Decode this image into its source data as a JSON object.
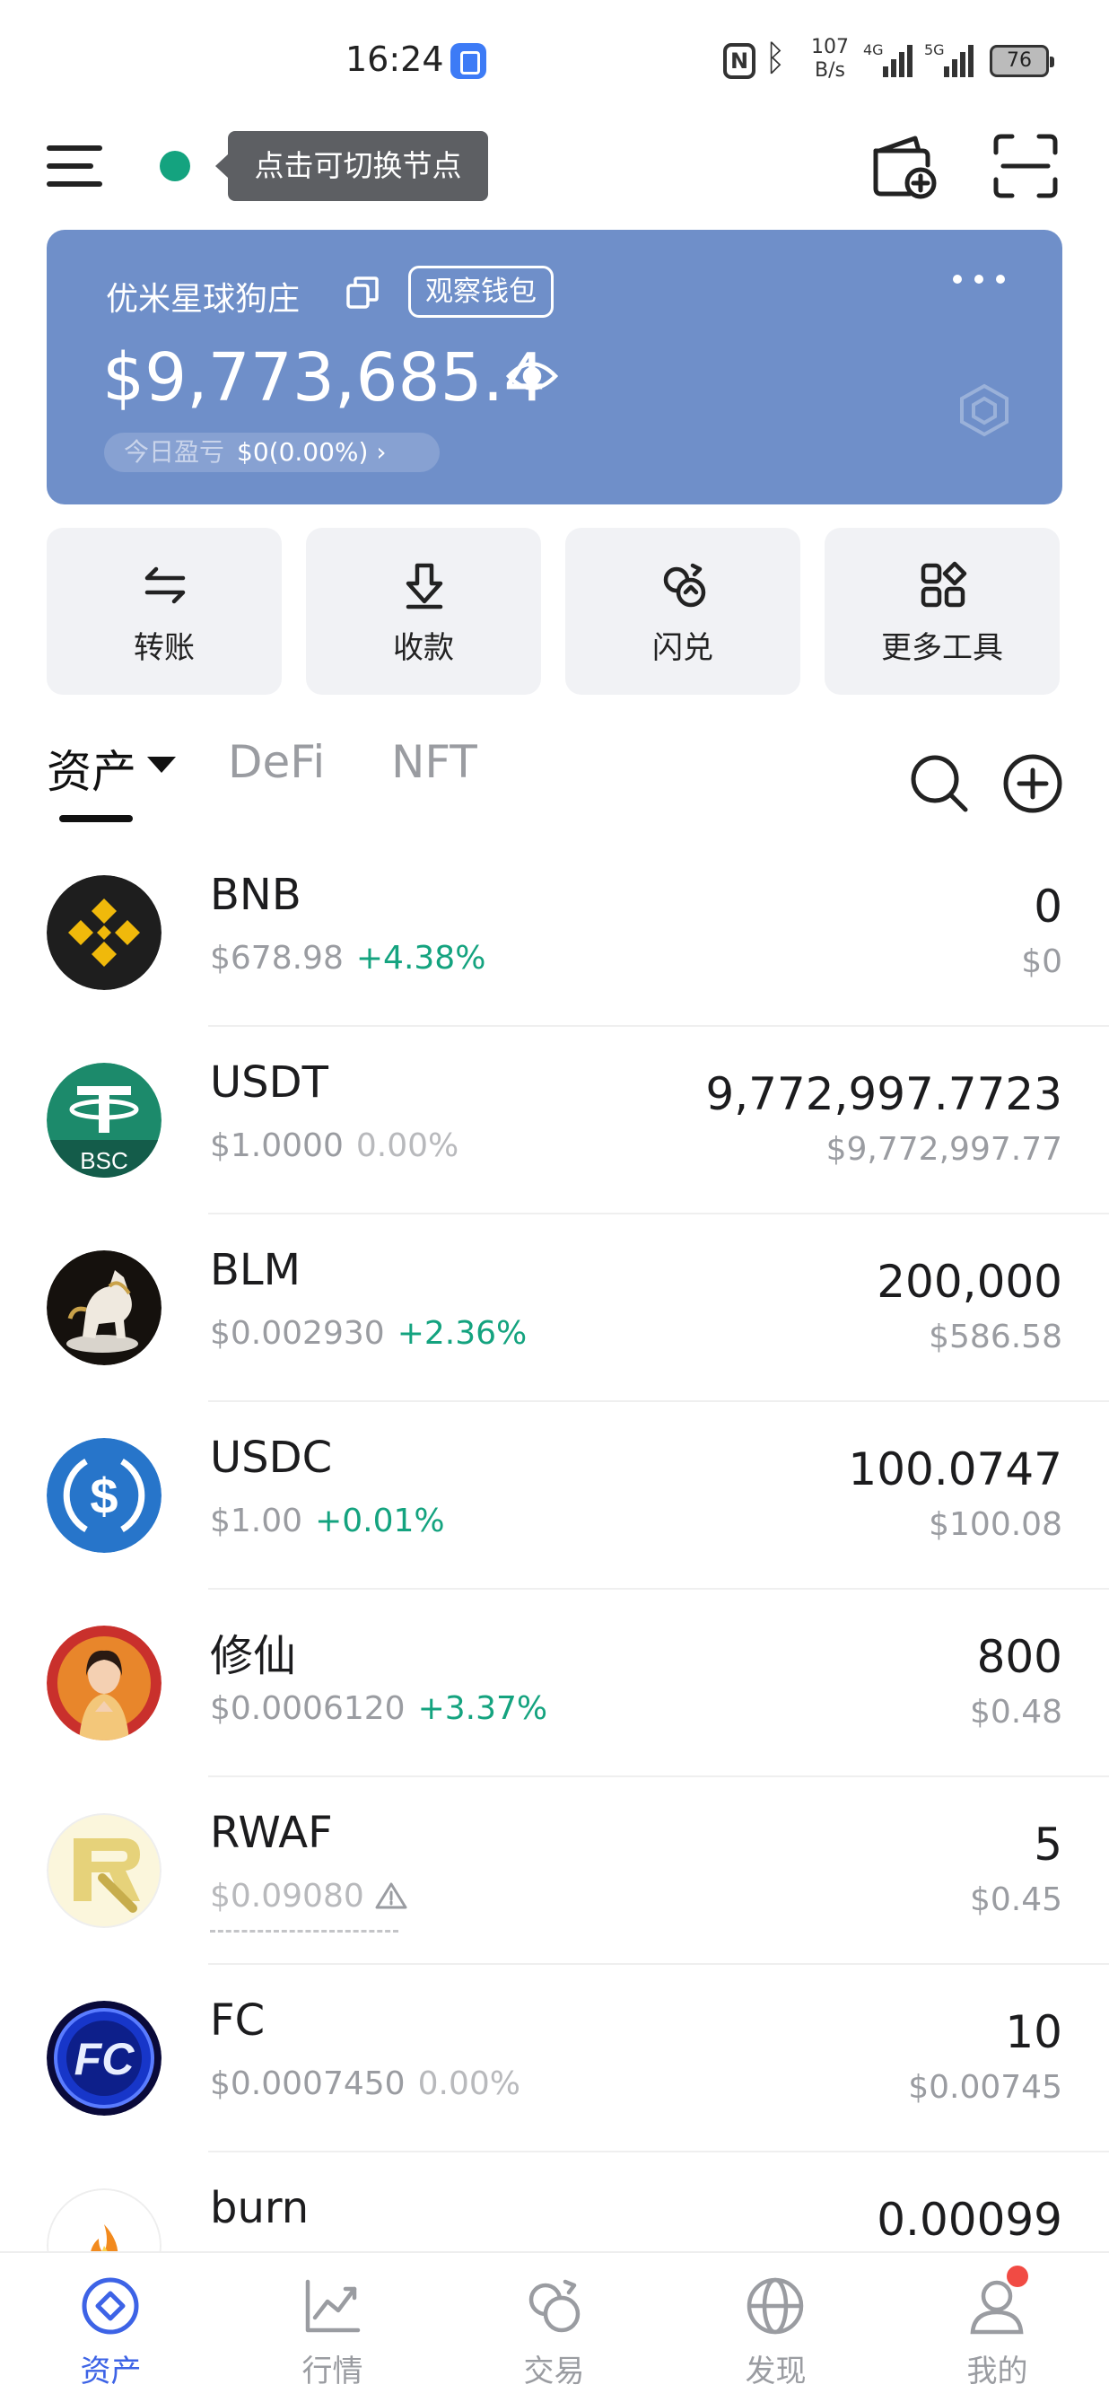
{
  "status_bar": {
    "time": "16:24",
    "net_speed_value": "107",
    "net_speed_unit": "B/s",
    "signal_1_type": "4G",
    "signal_2_type": "5G",
    "battery": "76",
    "icons": [
      "app-notification-icon",
      "nfc-icon",
      "bluetooth-icon",
      "signal-icon",
      "battery-icon"
    ]
  },
  "header": {
    "node_tooltip": "点击可切换节点",
    "node_status_color": "#14a37f"
  },
  "wallet_card": {
    "name": "优米星球狗庄",
    "badge": "观察钱包",
    "balance": "$9,773,685.4",
    "pnl_label": "今日盈亏",
    "pnl_value": "$0(0.00%)",
    "pnl_chevron": "›",
    "background_color": "#6f8fc9"
  },
  "actions": [
    {
      "label": "转账",
      "icon": "transfer-icon"
    },
    {
      "label": "收款",
      "icon": "receive-icon"
    },
    {
      "label": "闪兑",
      "icon": "swap-icon"
    },
    {
      "label": "更多工具",
      "icon": "more-tools-icon"
    }
  ],
  "tabs": [
    {
      "label": "资产",
      "active": true
    },
    {
      "label": "DeFi",
      "active": false
    },
    {
      "label": "NFT",
      "active": false
    }
  ],
  "tokens": [
    {
      "symbol": "BNB",
      "price": "$678.98",
      "change": "+4.38%",
      "change_state": "up",
      "amount": "0",
      "value": "$0"
    },
    {
      "symbol": "USDT",
      "price": "$1.0000",
      "change": "0.00%",
      "change_state": "flat",
      "amount": "9,772,997.7723",
      "value": "$9,772,997.77",
      "chain_tag": "BSC"
    },
    {
      "symbol": "BLM",
      "price": "$0.002930",
      "change": "+2.36%",
      "change_state": "up",
      "amount": "200,000",
      "value": "$586.58"
    },
    {
      "symbol": "USDC",
      "price": "$1.00",
      "change": "+0.01%",
      "change_state": "up",
      "amount": "100.0747",
      "value": "$100.08"
    },
    {
      "symbol": "修仙",
      "price": "$0.0006120",
      "change": "+3.37%",
      "change_state": "up",
      "amount": "800",
      "value": "$0.48"
    },
    {
      "symbol": "RWAF",
      "price": "$0.09080",
      "change": "",
      "change_state": "warning",
      "amount": "5",
      "value": "$0.45"
    },
    {
      "symbol": "FC",
      "price": "$0.0007450",
      "change": "0.00%",
      "change_state": "flat",
      "amount": "10",
      "value": "$0.00745"
    },
    {
      "symbol": "burn",
      "price": "",
      "change": "",
      "change_state": "",
      "amount": "0.00099",
      "value": ""
    }
  ],
  "colors": {
    "up": "#14a37f",
    "flat": "#b8b9bc",
    "accent": "#3d63e6",
    "badge_dot": "#f14b44"
  },
  "bottom_nav": [
    {
      "label": "资产",
      "icon": "assets-icon",
      "active": true
    },
    {
      "label": "行情",
      "icon": "market-icon",
      "active": false
    },
    {
      "label": "交易",
      "icon": "trade-icon",
      "active": false
    },
    {
      "label": "发现",
      "icon": "discover-icon",
      "active": false
    },
    {
      "label": "我的",
      "icon": "profile-icon",
      "active": false,
      "has_notification": true
    }
  ]
}
